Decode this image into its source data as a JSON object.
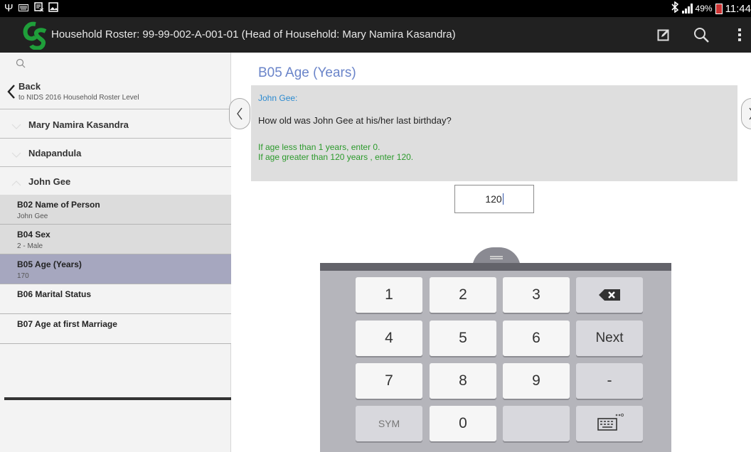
{
  "statusbar": {
    "battery_percent": "49%",
    "time": "11:44",
    "icons": [
      "usb-icon",
      "keyboard-notification-icon",
      "screenshot-icon",
      "image-icon",
      "bluetooth-icon",
      "signal-icon",
      "battery-icon"
    ]
  },
  "actionbar": {
    "title": "Household Roster: 99-99-002-A-001-01 (Head of Household: Mary Namira Kasandra)",
    "icons": [
      "edit-icon",
      "search-icon",
      "overflow-menu-icon"
    ],
    "accent": "#1f9e3a"
  },
  "sidebar": {
    "back": {
      "label": "Back",
      "sublabel": "to NIDS 2016 Household Roster Level"
    },
    "persons": [
      {
        "name": "Mary Namira Kasandra"
      },
      {
        "name": "Ndapandula"
      },
      {
        "name": "John Gee"
      }
    ],
    "questions": [
      {
        "title": "B02 Name of Person",
        "answer": "John Gee"
      },
      {
        "title": "B04 Sex",
        "answer": "2 - Male"
      },
      {
        "title": "B05 Age (Years)",
        "answer": "170"
      },
      {
        "title": "B06 Marital Status",
        "answer": ""
      },
      {
        "title": "B07 Age at first Marriage",
        "answer": ""
      }
    ],
    "selected_index": 2,
    "selected_color": "#a6a7bf"
  },
  "question": {
    "title": "B05 Age (Years)",
    "person_label": "John Gee:",
    "text": "How old was John Gee at his/her last birthday?",
    "hints": [
      "If age less than 1 years, enter 0.",
      "If age greater than 120 years , enter 120."
    ],
    "answer_value": "120",
    "title_color": "#6a84c9",
    "hint_color": "#2c9a2c"
  },
  "keyboard": {
    "keys": [
      "1",
      "2",
      "3",
      "4",
      "5",
      "6",
      "Next",
      "7",
      "8",
      "9",
      "-",
      "SYM",
      "0"
    ],
    "special_icons": [
      "backspace-icon",
      "keyboard-settings-icon"
    ]
  }
}
